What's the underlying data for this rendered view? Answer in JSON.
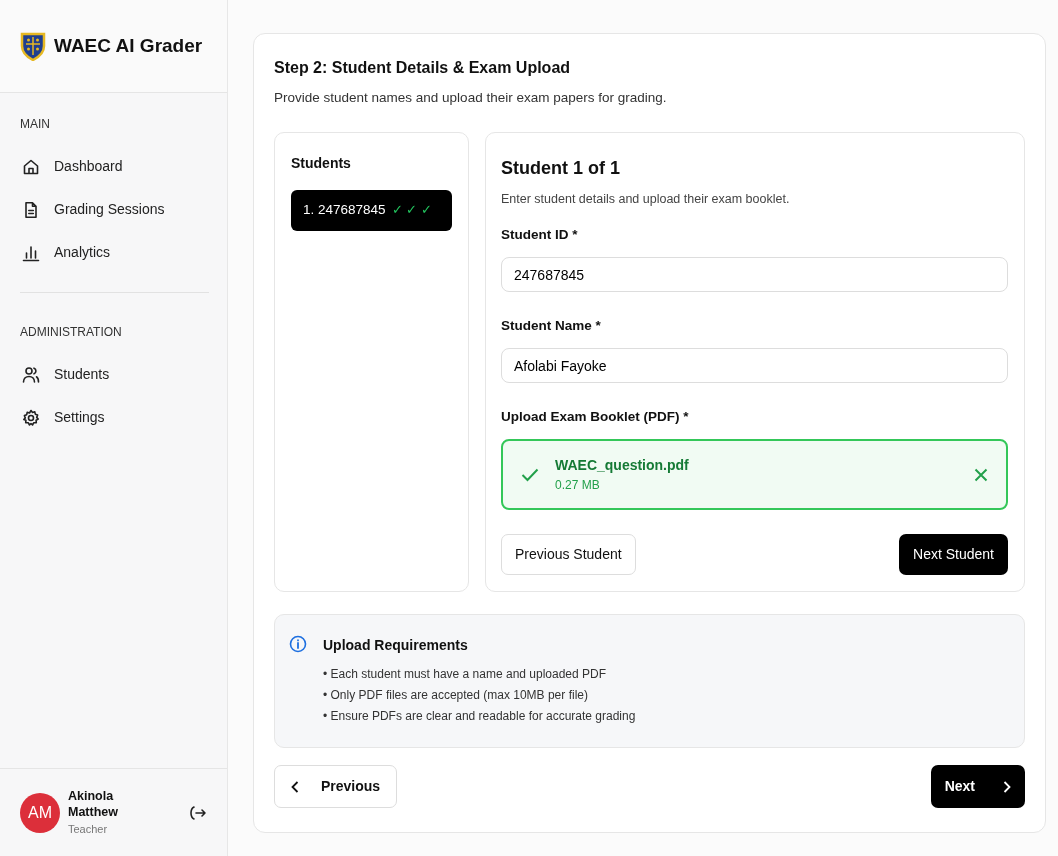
{
  "sidebar": {
    "brand": "WAEC AI Grader",
    "sections": [
      {
        "title": "MAIN",
        "items": [
          {
            "label": "Dashboard",
            "kind": "home"
          },
          {
            "label": "Grading Sessions",
            "kind": "file"
          },
          {
            "label": "Analytics",
            "kind": "chart"
          }
        ]
      },
      {
        "title": "ADMINISTRATION",
        "items": [
          {
            "label": "Students",
            "kind": "users"
          },
          {
            "label": "Settings",
            "kind": "gear"
          }
        ]
      }
    ],
    "user": {
      "initials": "AM",
      "name": "Akinola Matthew",
      "role": "Teacher"
    }
  },
  "step": {
    "title": "Step 2: Student Details & Exam Upload",
    "subtitle": "Provide student names and upload their exam papers for grading."
  },
  "students_panel": {
    "title": "Students",
    "items": [
      {
        "label": "1. 247687845",
        "checks": "✓ ✓ ✓",
        "selected": true
      }
    ]
  },
  "form": {
    "title": "Student 1 of 1",
    "subtitle": "Enter student details and upload their exam booklet.",
    "fields": [
      {
        "label": "Student ID *",
        "value": "247687845"
      },
      {
        "label": "Student Name *",
        "value": "Afolabi Fayoke"
      }
    ],
    "upload": {
      "label": "Upload Exam Booklet (PDF) *",
      "file_name": "WAEC_question.pdf",
      "file_size": "0.27 MB",
      "uploaded": true
    },
    "prev_button": "Previous Student",
    "next_button": "Next Student"
  },
  "requirements": {
    "title": "Upload Requirements",
    "items": [
      "• Each student must have a name and uploaded PDF",
      "• Only PDF files are accepted (max 10MB per file)",
      "• Ensure PDFs are clear and readable for accurate grading"
    ]
  },
  "nav": {
    "previous": "Previous",
    "next": "Next"
  }
}
